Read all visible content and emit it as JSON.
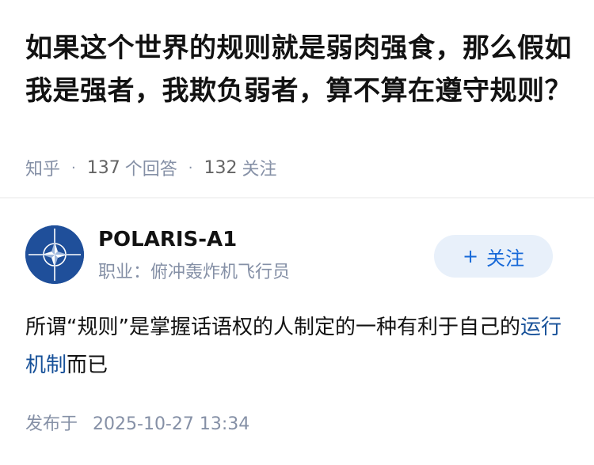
{
  "question": {
    "title": "如果这个世界的规则就是弱肉强食，那么假如我是强者，我欺负弱者，算不算在遵守规则？"
  },
  "meta": {
    "source": "知乎",
    "answers_count": "137",
    "answers_label": "个回答",
    "followers_count": "132",
    "followers_label": "关注",
    "separator": "·"
  },
  "author": {
    "name": "POLARIS-A1",
    "headline": "职业：俯冲轰炸机飞行员",
    "avatar_icon": "nato-compass-icon"
  },
  "follow_button": {
    "plus": "+",
    "label": "关注"
  },
  "answer": {
    "text_before": "所谓“规则”是掌握话语权的人制定的一种有利于自己的",
    "link_text": "运行机制",
    "text_after": "而已"
  },
  "publish": {
    "label": "发布于",
    "datetime": "2025-10-27 13:34"
  },
  "colors": {
    "accent": "#1769d8",
    "link": "#175199",
    "muted": "#8590a6",
    "avatar_bg": "#1f4f9a"
  }
}
